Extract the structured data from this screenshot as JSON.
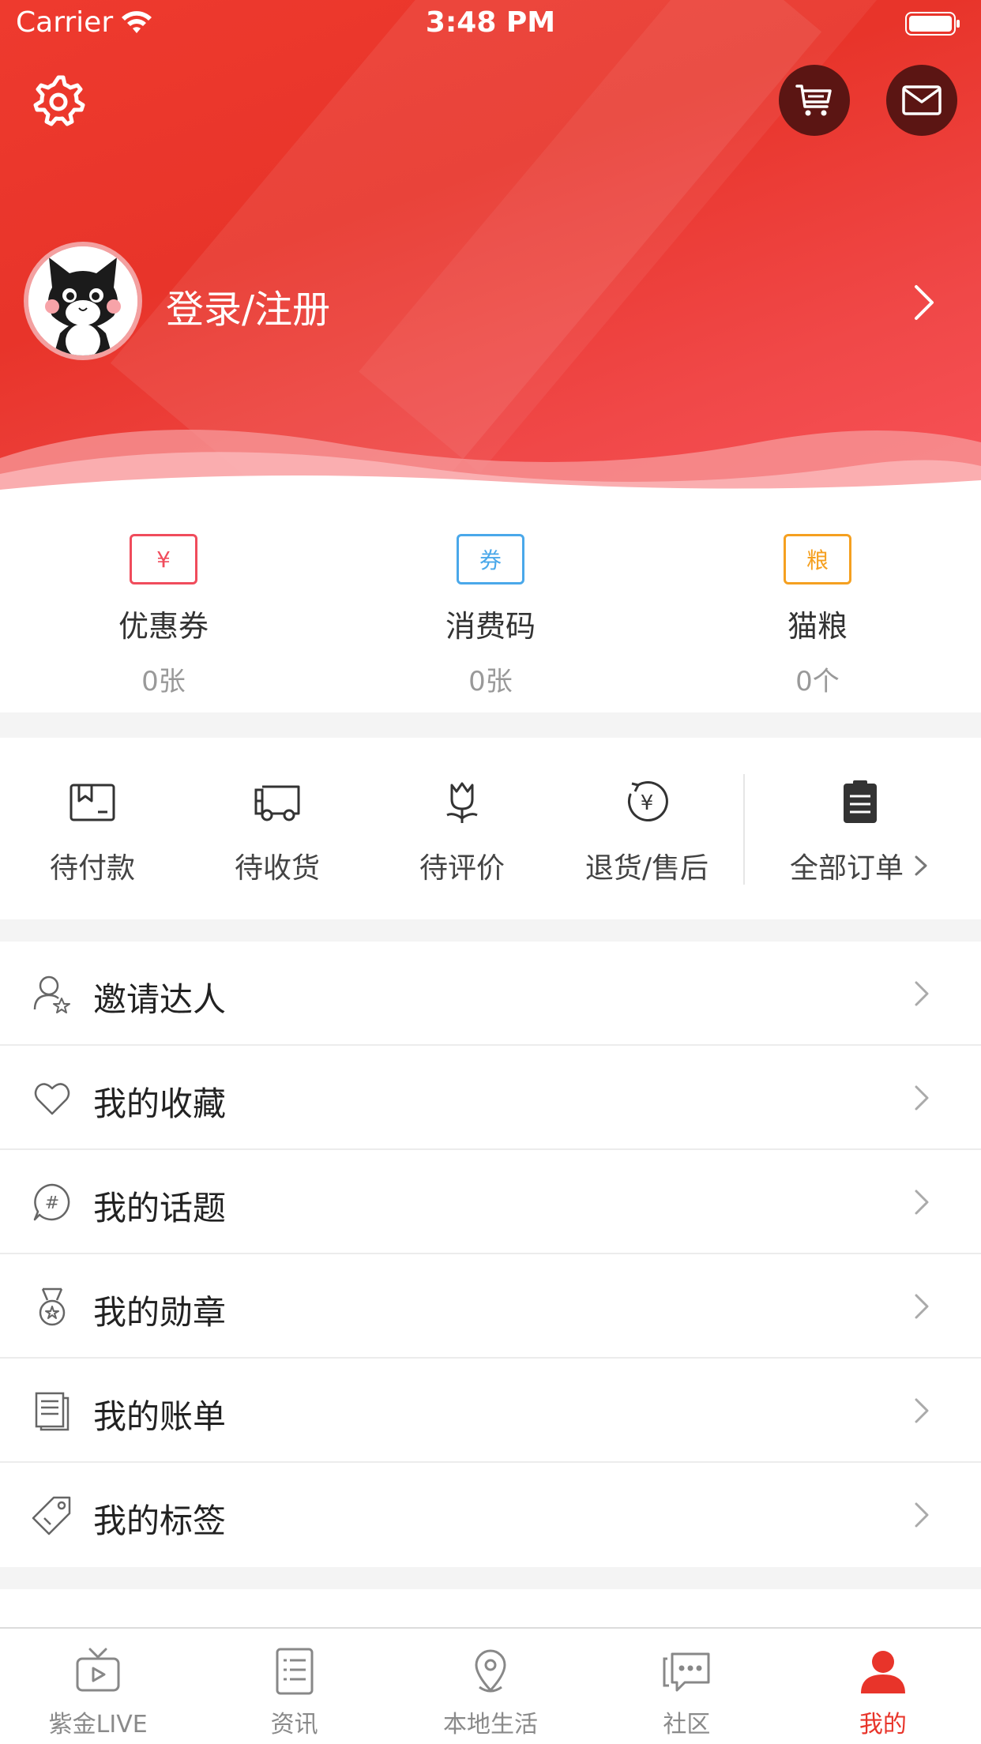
{
  "status_bar": {
    "carrier": "Carrier",
    "time": "3:48 PM"
  },
  "header": {
    "login_label": "登录/注册",
    "colors": {
      "gradient_start": "#ee3a2e",
      "gradient_end": "#f85258",
      "button_bg": "#5b1513"
    },
    "icons": [
      "gear-icon",
      "cart-icon",
      "mail-icon",
      "chevron-right-icon"
    ]
  },
  "assets": [
    {
      "title": "优惠券",
      "count": "0张",
      "badge": "¥",
      "color": "#f04c5c"
    },
    {
      "title": "消费码",
      "count": "0张",
      "badge": "券",
      "color": "#4aa8ea"
    },
    {
      "title": "猫粮",
      "count": "0个",
      "badge": "粮",
      "color": "#f5a020"
    }
  ],
  "orders": {
    "items": [
      {
        "label": "待付款",
        "icon": "wallet-icon"
      },
      {
        "label": "待收货",
        "icon": "truck-icon"
      },
      {
        "label": "待评价",
        "icon": "tulip-icon"
      },
      {
        "label": "退货/售后",
        "icon": "refund-icon"
      }
    ],
    "all_label": "全部订单"
  },
  "menu": [
    {
      "label": "邀请达人",
      "icon": "user-star-icon"
    },
    {
      "label": "我的收藏",
      "icon": "heart-icon"
    },
    {
      "label": "我的话题",
      "icon": "hashtag-icon"
    },
    {
      "label": "我的勋章",
      "icon": "medal-icon"
    },
    {
      "label": "我的账单",
      "icon": "bill-icon"
    },
    {
      "label": "我的标签",
      "icon": "tag-icon"
    }
  ],
  "tabbar": {
    "items": [
      {
        "label": "紫金LIVE",
        "icon": "tv-icon",
        "active": false
      },
      {
        "label": "资讯",
        "icon": "news-icon",
        "active": false
      },
      {
        "label": "本地生活",
        "icon": "location-icon",
        "active": false
      },
      {
        "label": "社区",
        "icon": "chat-icon",
        "active": false
      },
      {
        "label": "我的",
        "icon": "person-icon",
        "active": true
      }
    ],
    "active_color": "#e8342a"
  }
}
